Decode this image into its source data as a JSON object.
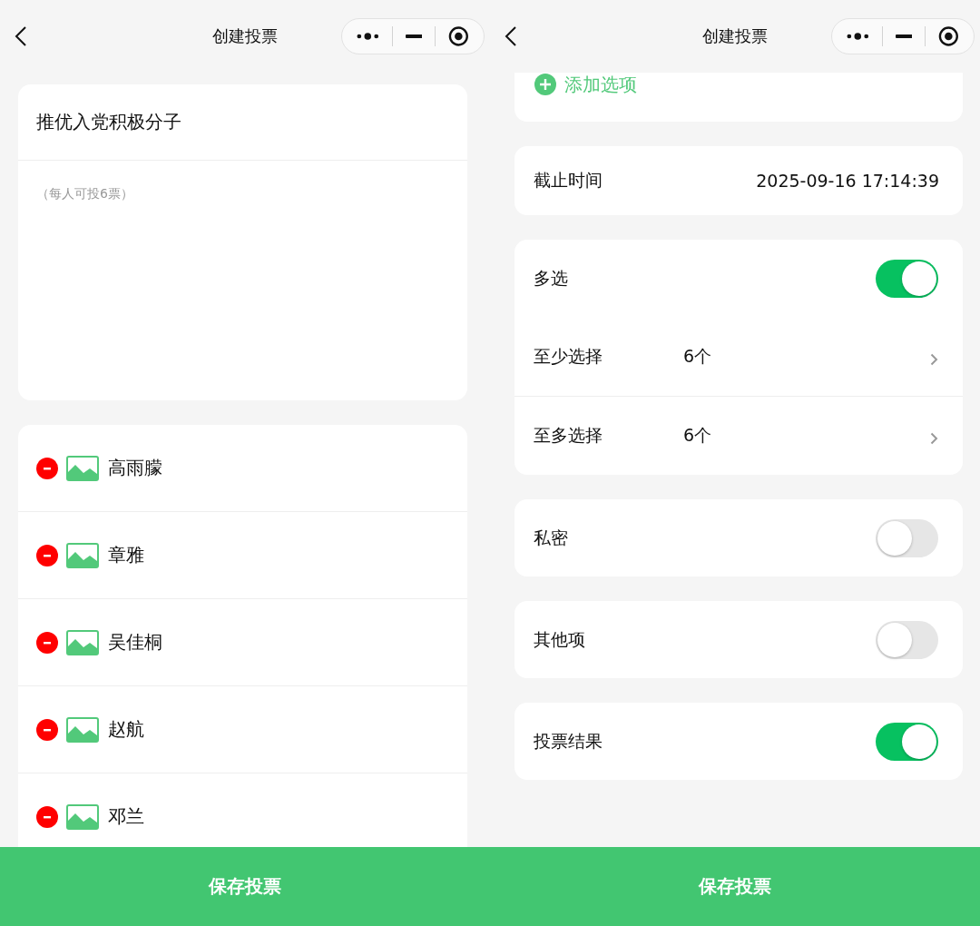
{
  "screens": [
    {
      "title": "创建投票",
      "question": "推优入党积极分子",
      "description": {
        "placeholder": "（每人可投6票）"
      },
      "options": [
        {
          "name": "高雨朦"
        },
        {
          "name": "章雅"
        },
        {
          "name": "吴佳桐"
        },
        {
          "name": "赵航"
        },
        {
          "name": "邓兰"
        }
      ],
      "save_button": "保存投票"
    },
    {
      "title": "创建投票",
      "add_option": "添加选项",
      "setting_groups": [
        {
          "rows": [
            {
              "kind": "value",
              "label": "截止时间",
              "value": "2025-09-16 17:14:39"
            }
          ]
        },
        {
          "rows": [
            {
              "kind": "toggle",
              "label": "多选",
              "on": true
            },
            {
              "kind": "picker",
              "label": "至少选择",
              "value": "6个"
            },
            {
              "kind": "picker",
              "label": "至多选择",
              "value": "6个"
            }
          ]
        },
        {
          "rows": [
            {
              "kind": "toggle",
              "label": "私密",
              "on": false
            }
          ]
        },
        {
          "rows": [
            {
              "kind": "toggle",
              "label": "其他项",
              "on": false
            }
          ]
        },
        {
          "rows": [
            {
              "kind": "toggle",
              "label": "投票结果",
              "on": true
            }
          ]
        }
      ],
      "save_button": "保存投票"
    }
  ]
}
